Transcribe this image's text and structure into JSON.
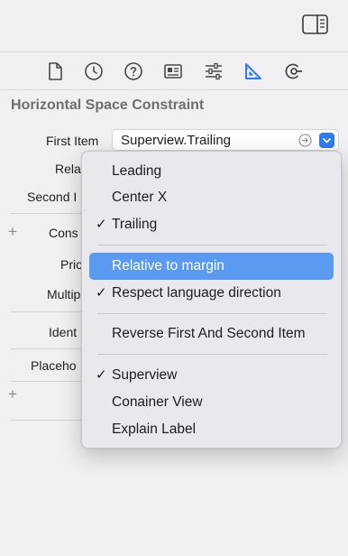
{
  "section_title": "Horizontal Space Constraint",
  "fields": {
    "first_item_label": "First Item",
    "first_item_value": "Superview.Trailing",
    "relation_label": "Rela",
    "second_item_label": "Second I",
    "constant_label": "Cons",
    "priority_label": "Prio",
    "multiplier_label": "Multip",
    "identifier_label": "Ident",
    "placeholder_label": "Placeho"
  },
  "menu": {
    "items": [
      {
        "label": "Leading",
        "checked": false
      },
      {
        "label": "Center X",
        "checked": false
      },
      {
        "label": "Trailing",
        "checked": true
      },
      {
        "label": "Relative to margin",
        "checked": false,
        "highlighted": true
      },
      {
        "label": "Respect language direction",
        "checked": true
      },
      {
        "label": "Reverse First And Second Item",
        "checked": false
      },
      {
        "label": "Superview",
        "checked": true
      },
      {
        "label": "Conainer View",
        "checked": false
      },
      {
        "label": "Explain Label",
        "checked": false
      }
    ],
    "check_glyph": "✓"
  },
  "plus_glyph": "+",
  "colors": {
    "accent": "#2f7bf6",
    "selected_tab": "#2f7bf6",
    "highlight": "#5a9bf1",
    "background": "#f1eff1"
  },
  "tabs": [
    {
      "icon": "file-icon",
      "selected": false
    },
    {
      "icon": "clock-icon",
      "selected": false
    },
    {
      "icon": "help-icon",
      "selected": false
    },
    {
      "icon": "identity-card-icon",
      "selected": false
    },
    {
      "icon": "sliders-icon",
      "selected": false
    },
    {
      "icon": "ruler-icon",
      "selected": true
    },
    {
      "icon": "connections-icon",
      "selected": false
    }
  ]
}
